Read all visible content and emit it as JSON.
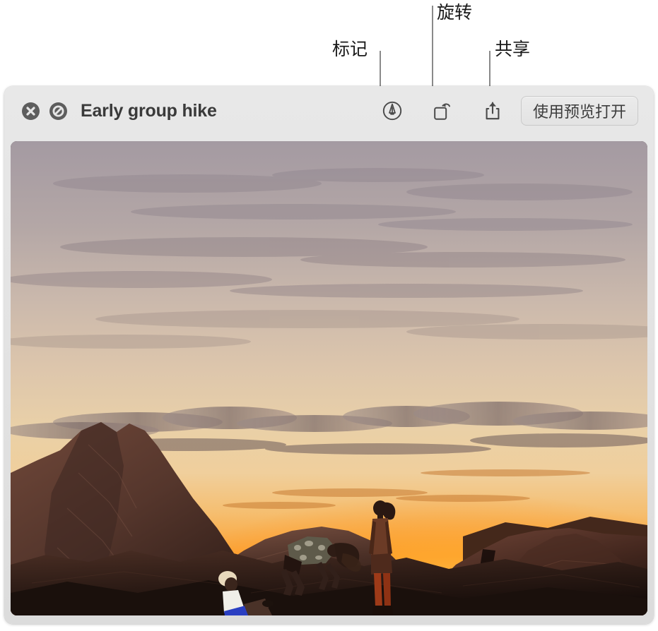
{
  "callouts": [
    {
      "id": "markup",
      "label": "标记",
      "target": "markup-tool"
    },
    {
      "id": "rotate",
      "label": "旋转",
      "target": "rotate-tool"
    },
    {
      "id": "share",
      "label": "共享",
      "target": "share-tool"
    }
  ],
  "window": {
    "title": "Early group hike",
    "controls": [
      {
        "name": "close-button",
        "glyph": "close-icon"
      },
      {
        "name": "markup-toggle-button",
        "glyph": "no-entry-icon"
      }
    ],
    "toolbar": {
      "markup_label": "标记",
      "rotate_label": "旋转",
      "share_label": "共享",
      "open_button_label": "使用预览打开"
    }
  },
  "photo": {
    "description": "Three hikers silhouetted on red sandstone rocks at sunset",
    "colors": {
      "sky_top": "#a9a0a6",
      "sky_mid": "#d8c2ac",
      "sky_warm": "#efd4a8",
      "sun_glow": "#ff9417",
      "sun_core": "#ffb43a",
      "rock_light": "#8a6354",
      "rock_mid": "#55372e",
      "rock_dark": "#2e1d18",
      "rock_darkest": "#1d120f",
      "silhouette": "#2b1712"
    }
  },
  "ui_colors": {
    "titlebar_bg": "#e4e4e4",
    "title_text": "#3a3a3a",
    "control_bg": "#5d5d5d",
    "icon_stroke": "#4a4a4a",
    "leader_line": "#8a8a8a",
    "callout_text": "#1a1a1a"
  }
}
